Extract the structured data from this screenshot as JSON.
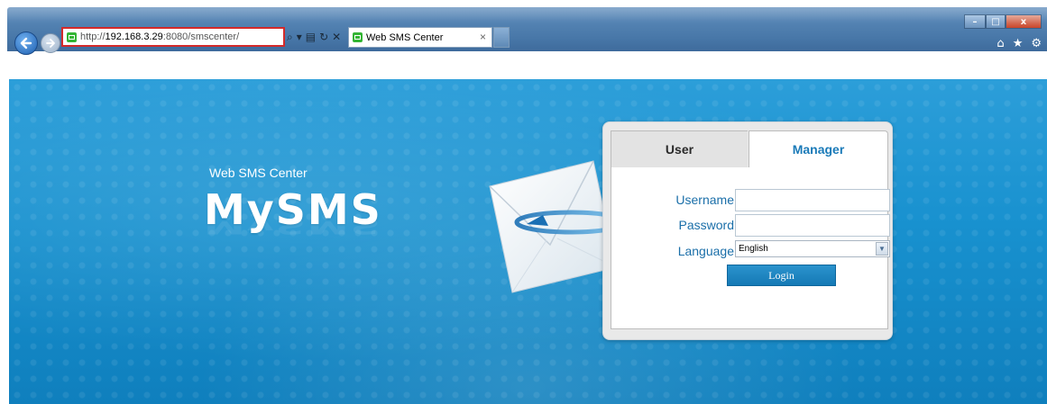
{
  "browser": {
    "url_prefix": "http://",
    "url_host": "192.168.3.29",
    "url_rest": ":8080/smscenter/",
    "tab_title": "Web SMS Center",
    "tab_close_glyph": "×",
    "toolbar_glyphs": {
      "search": "⌕",
      "dropdown": "▾",
      "compat": "▤",
      "refresh": "↻",
      "stop": "✕",
      "home": "⌂",
      "favorites": "★",
      "tools": "⚙"
    },
    "window_controls": {
      "minimize": "–",
      "maximize": "□",
      "close": "x"
    }
  },
  "banner": {
    "subtitle": "Web SMS Center",
    "brand": "MySMS"
  },
  "login": {
    "tabs": [
      {
        "label": "User",
        "active": false
      },
      {
        "label": "Manager",
        "active": true
      }
    ],
    "username_label": "Username",
    "username_value": "",
    "password_label": "Password",
    "password_value": "",
    "language_label": "Language",
    "language_selected": "English",
    "submit_label": "Login"
  },
  "colors": {
    "banner_blue": "#1891cf",
    "label_blue": "#1b6fa9",
    "active_tab_text": "#1a7ab8",
    "button_blue": "#1579b5",
    "highlight_red": "#d32a2a"
  }
}
